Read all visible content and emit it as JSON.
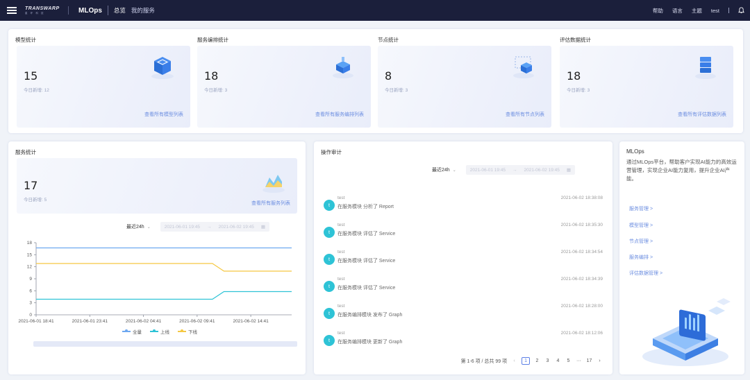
{
  "header": {
    "logo_line1": "TRANSWARP",
    "logo_line2": "星 环 科 技",
    "app_name": "MLOps",
    "tabs": [
      {
        "label": "总览",
        "active": true
      },
      {
        "label": "我的服务",
        "active": false
      }
    ],
    "right": {
      "help": "帮助",
      "language": "语言",
      "theme": "主题",
      "user": "test"
    }
  },
  "stats": {
    "cards": [
      {
        "title": "模型统计",
        "value": "15",
        "sub": "今日新增: 12",
        "link": "查看所有模型列表",
        "icon": "model-cube-icon"
      },
      {
        "title": "服务编排统计",
        "value": "18",
        "sub": "今日新增: 3",
        "link": "查看所有服务编排列表",
        "icon": "orchestration-cube-icon"
      },
      {
        "title": "节点统计",
        "value": "8",
        "sub": "今日新增: 3",
        "link": "查看所有节点列表",
        "icon": "node-cube-icon"
      },
      {
        "title": "评估数据统计",
        "value": "18",
        "sub": "今日新增: 3",
        "link": "查看所有评估数据列表",
        "icon": "database-stack-icon"
      }
    ]
  },
  "service_stats": {
    "title": "服务统计",
    "value": "17",
    "sub": "今日新增: 5",
    "link": "查看所有服务列表",
    "range_label": "最近24h",
    "start_placeholder": "2021-06-01 19:45",
    "end_placeholder": "2021-06-02 19:45"
  },
  "chart_data": {
    "type": "line",
    "x": [
      "2021-06-01 18:41",
      "2021-06-01 23:41",
      "2021-06-02 04:41",
      "2021-06-02 09:41",
      "2021-06-02 14:41"
    ],
    "yticks": [
      0,
      3,
      6,
      9,
      12,
      15,
      18
    ],
    "ylim": [
      0,
      18
    ],
    "series": [
      {
        "name": "全量",
        "color": "#6ea8f0",
        "points": [
          [
            0,
            16.7
          ],
          [
            1,
            16.7
          ]
        ]
      },
      {
        "name": "上线",
        "color": "#2ec3d6",
        "points": [
          [
            0,
            3.9
          ],
          [
            0.69,
            3.9
          ],
          [
            0.735,
            5.8
          ],
          [
            1,
            5.8
          ]
        ]
      },
      {
        "name": "下线",
        "color": "#f5c842",
        "points": [
          [
            0,
            12.8
          ],
          [
            0.69,
            12.8
          ],
          [
            0.735,
            10.9
          ],
          [
            1,
            10.9
          ]
        ]
      }
    ],
    "legend_position": "bottom",
    "grid": false
  },
  "audit": {
    "title": "操作审计",
    "range_label": "最近24h",
    "start_placeholder": "2021-06-01 19:45",
    "end_placeholder": "2021-06-02 19:45",
    "items": [
      {
        "avatar": "t",
        "user": "test",
        "text": "在服务模块 分析了 Report",
        "time": "2021-06-02 18:38:08"
      },
      {
        "avatar": "t",
        "user": "test",
        "text": "在服务模块 评估了 Service",
        "time": "2021-06-02 18:35:30"
      },
      {
        "avatar": "t",
        "user": "test",
        "text": "在服务模块 评估了 Service",
        "time": "2021-06-02 18:34:54"
      },
      {
        "avatar": "t",
        "user": "test",
        "text": "在服务模块 评估了 Service",
        "time": "2021-06-02 18:34:39"
      },
      {
        "avatar": "t",
        "user": "test",
        "text": "在服务编排模块 发布了 Graph",
        "time": "2021-06-02 18:28:00"
      },
      {
        "avatar": "t",
        "user": "test",
        "text": "在服务编排模块 更新了 Graph",
        "time": "2021-06-02 18:12:06"
      }
    ],
    "pager": {
      "summary": "第 1-6 项 / 总共 99 项",
      "pages": [
        "1",
        "2",
        "3",
        "4",
        "5",
        "···",
        "17"
      ],
      "current": "1"
    }
  },
  "intro": {
    "title": "MLOps",
    "text": "通过MLOps平台，帮助客户实现AI能力的高效运营管理，实现企业AI能力复用，提升企业AI产能。",
    "links": [
      "服务管理 >",
      "模型管理 >",
      "节点管理 >",
      "服务编排 >",
      "评估数据管理 >"
    ]
  },
  "colors": {
    "nav_bg": "#1b1f3b",
    "accent": "#6c8ee0",
    "teal": "#2ec3d6",
    "yellow": "#f5c842",
    "blue_line": "#6ea8f0"
  }
}
